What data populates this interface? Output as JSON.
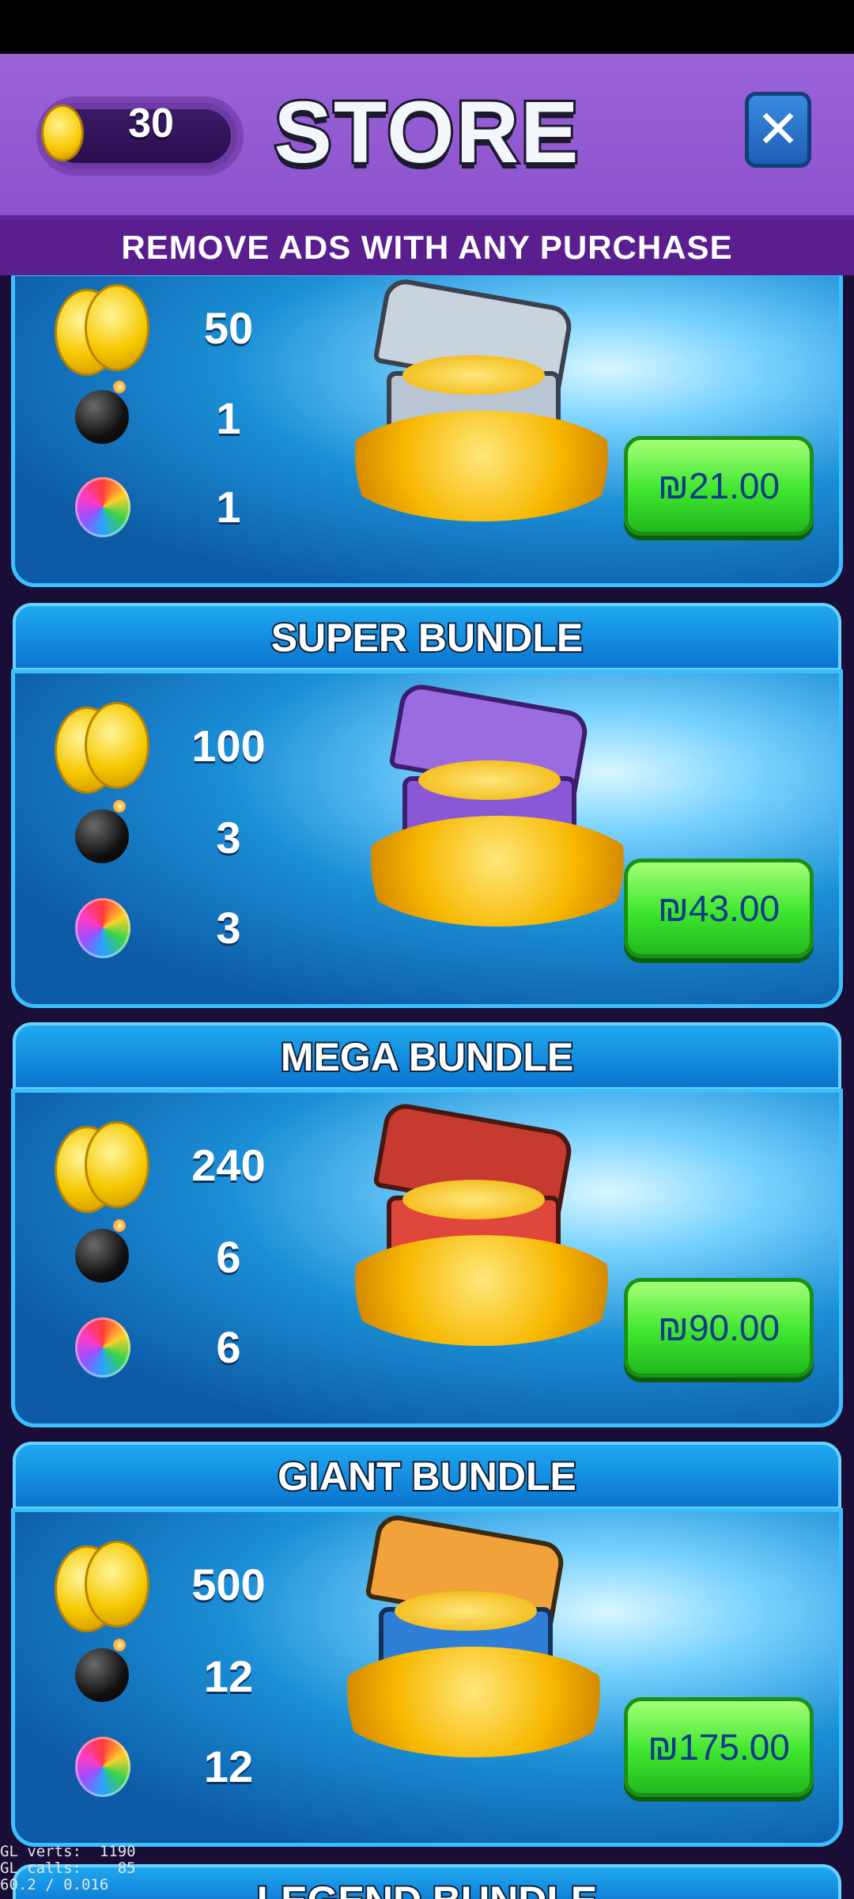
{
  "header": {
    "coin_count": "30",
    "title": "STORE",
    "close_label": "✕"
  },
  "banner": "REMOVE ADS WITH ANY PURCHASE",
  "bundles": [
    {
      "name": "",
      "coins": "50",
      "bombs": "1",
      "rainbows": "1",
      "price": "₪21.00",
      "chest_color": "#c9d3de",
      "chest_trim": "#e24b2b"
    },
    {
      "name": "SUPER BUNDLE",
      "coins": "100",
      "bombs": "3",
      "rainbows": "3",
      "price": "₪43.00",
      "chest_color": "#9b6be0",
      "chest_trim": "#3f8ee8"
    },
    {
      "name": "MEGA BUNDLE",
      "coins": "240",
      "bombs": "6",
      "rainbows": "6",
      "price": "₪90.00",
      "chest_color": "#e0473c",
      "chest_trim": "#8e8e8e"
    },
    {
      "name": "GIANT BUNDLE",
      "coins": "500",
      "bombs": "12",
      "rainbows": "12",
      "price": "₪175.00",
      "chest_color": "#2f7fd8",
      "chest_trim": "#f2a23a"
    }
  ],
  "next_bundle_name": "LEGEND BUNDLE",
  "debug": {
    "line1": "GL verts:  1190",
    "line2": "GL calls:    85",
    "line3": "60.2 / 0.016"
  },
  "colors": {
    "header_purple": "#9b63d8",
    "price_green": "#3ee62f",
    "card_blue": "#1b8fd6"
  }
}
